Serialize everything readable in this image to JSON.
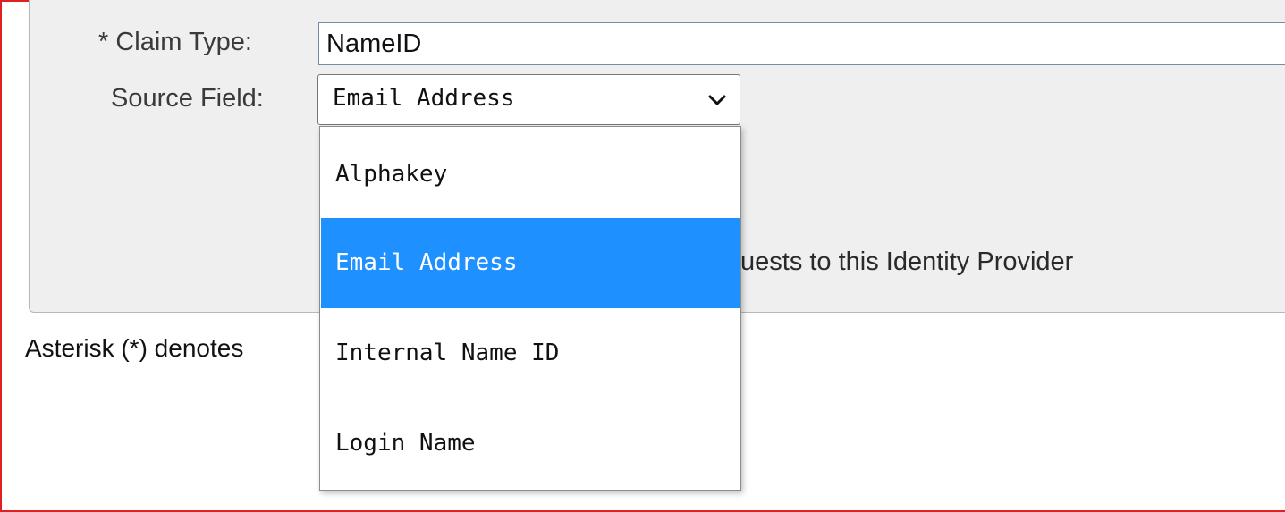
{
  "form": {
    "claim_type_label": "* Claim Type:",
    "claim_type_value": "NameID",
    "source_field_label": "Source Field:",
    "source_field_value": "Email Address",
    "source_field_chevron_icon": "chevron-down-icon",
    "partial_background_text": "uests to this Identity Provider",
    "asterisk_note_visible": "Asterisk (*) denotes"
  },
  "dropdown": {
    "options": [
      {
        "label": "Alphakey",
        "selected": false
      },
      {
        "label": "Email Address",
        "selected": true
      },
      {
        "label": "Internal Name ID",
        "selected": false
      },
      {
        "label": "Login Name",
        "selected": false
      }
    ],
    "highlight_color": "#1e90ff"
  },
  "colors": {
    "frame_border": "#e02020",
    "panel_background": "#efefef"
  }
}
